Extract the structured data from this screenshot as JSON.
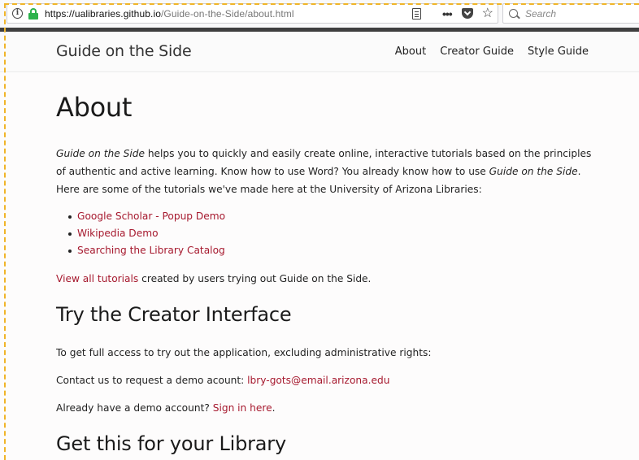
{
  "browser": {
    "url_host": "https://ualibraries.github.io",
    "url_path": "/Guide-on-the-Side/about.html",
    "search_placeholder": "Search",
    "menu_glyph": "•••",
    "star_glyph": "☆",
    "info_glyph": "i"
  },
  "header": {
    "site_title": "Guide on the Side",
    "nav": [
      "About",
      "Creator Guide",
      "Style Guide"
    ]
  },
  "main": {
    "title": "About",
    "intro": {
      "part1_em": "Guide on the Side",
      "part2": " helps you to quickly and easily create online, interactive tutorials based on the principles of authentic and active learning. Know how to use Word? You already know how to use ",
      "part3_em": "Guide on the Side",
      "part4": ". Here are some of the tutorials we've made here at the University of Arizona Libraries:"
    },
    "tutorials": [
      "Google Scholar - Popup Demo",
      "Wikipedia Demo",
      "Searching the Library Catalog"
    ],
    "view_all_link": "View all tutorials",
    "view_all_rest": " created by users trying out Guide on the Side.",
    "creator_heading": "Try the Creator Interface",
    "access_text": "To get full access to try out the application, excluding administrative rights:",
    "contact_text": "Contact us to request a demo acount: ",
    "contact_email": "lbry-gots@email.arizona.edu",
    "signin_text": "Already have a demo account? ",
    "signin_link": "Sign in here",
    "signin_end": ".",
    "library_heading": "Get this for your Library"
  },
  "colors": {
    "link": "#a6192e",
    "lock": "#2bb24c",
    "frame": "#f0b429"
  }
}
